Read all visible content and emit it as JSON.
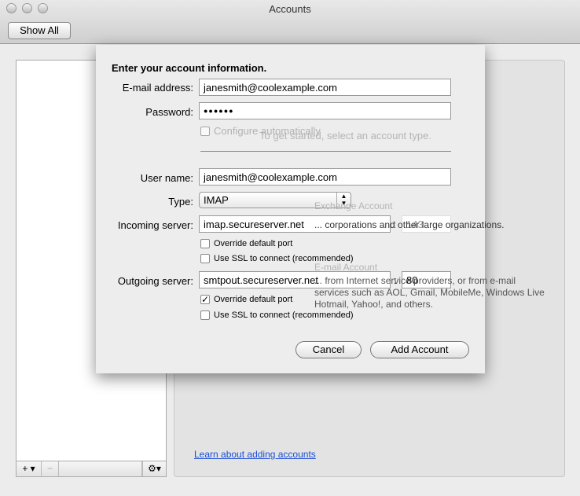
{
  "window": {
    "title": "Accounts",
    "show_all": "Show All"
  },
  "background": {
    "prompt": "To get started, select an account type.",
    "exchange_title": "Exchange Account",
    "exchange_desc": "... corporations and other large organizations.",
    "email_title": "E-mail Account",
    "email_desc": "... from Internet service providers, or from e-mail services such as AOL, Gmail, MobileMe, Windows Live Hotmail, Yahoo!, and others.",
    "learn_link": "Learn about adding accounts"
  },
  "list_toolbar": {
    "add": "+ ▾",
    "remove": "−",
    "gear": "⚙▾"
  },
  "sheet": {
    "heading": "Enter your account information.",
    "email_label": "E-mail address:",
    "email": "janesmith@coolexample.com",
    "password_label": "Password:",
    "password": "●●●●●●",
    "configure_auto": "Configure automatically",
    "username_label": "User name:",
    "username": "janesmith@coolexample.com",
    "type_label": "Type:",
    "type": "IMAP",
    "incoming_label": "Incoming server:",
    "incoming": "imap.secureserver.net",
    "incoming_port": "143",
    "incoming_override": "Override default port",
    "incoming_ssl": "Use SSL to connect (recommended)",
    "outgoing_label": "Outgoing server:",
    "outgoing": "smtpout.secureserver.net",
    "outgoing_port": "80",
    "outgoing_override": "Override default port",
    "outgoing_ssl": "Use SSL to connect (recommended)",
    "outgoing_override_checked": true,
    "colon": ":",
    "cancel": "Cancel",
    "add_account": "Add Account"
  }
}
